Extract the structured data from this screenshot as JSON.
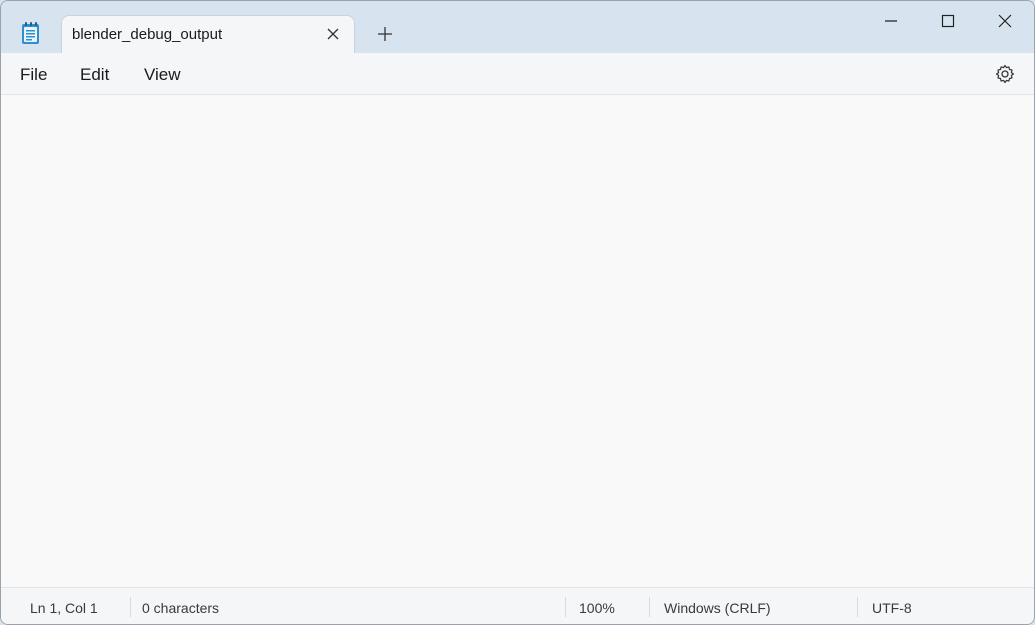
{
  "tab": {
    "title": "blender_debug_output"
  },
  "menu": {
    "file": "File",
    "edit": "Edit",
    "view": "View"
  },
  "status": {
    "position": "Ln 1, Col 1",
    "characters": "0 characters",
    "zoom": "100%",
    "line_ending": "Windows (CRLF)",
    "encoding": "UTF-8"
  },
  "icons": {
    "app": "notepad-icon",
    "close_tab": "close-icon",
    "new_tab": "plus-icon",
    "minimize": "minimize-icon",
    "maximize": "maximize-icon",
    "close_window": "close-icon",
    "settings": "gear-icon"
  },
  "colors": {
    "titlebar": "#d7e3ef",
    "accent": "#1a6fb5"
  }
}
